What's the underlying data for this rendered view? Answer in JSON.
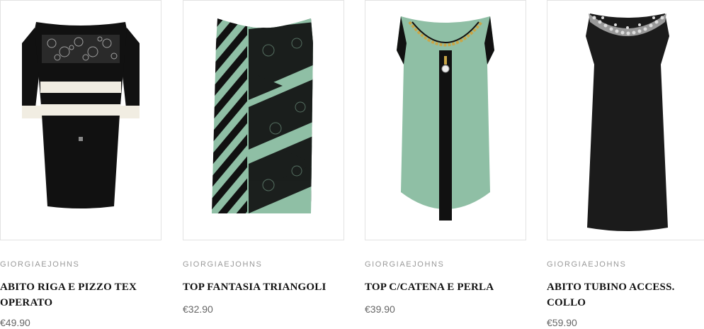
{
  "products": [
    {
      "brand": "GIORGIAEJOHNS",
      "title": "ABITO RIGA E PIZZO TEX OPERATO",
      "price": "€49.90",
      "image_alt": "black-white-striped-lace-dress"
    },
    {
      "brand": "GIORGIAEJOHNS",
      "title": "TOP FANTASIA TRIANGOLI",
      "price": "€32.90",
      "image_alt": "mint-stripe-lace-top"
    },
    {
      "brand": "GIORGIAEJOHNS",
      "title": "TOP C/CATENA E PERLA",
      "price": "€39.90",
      "image_alt": "mint-chain-pearl-top"
    },
    {
      "brand": "GIORGIAEJOHNS",
      "title": "ABITO TUBINO ACCESS. COLLO",
      "price": "€59.90",
      "image_alt": "black-sheath-dress-jeweled-collar"
    }
  ],
  "colors": {
    "black": "#111111",
    "mint": "#8fbfa5",
    "cream": "#f1ede2",
    "border": "#e3e3e3",
    "brand_text": "#9a9a9a",
    "price_text": "#666666"
  }
}
